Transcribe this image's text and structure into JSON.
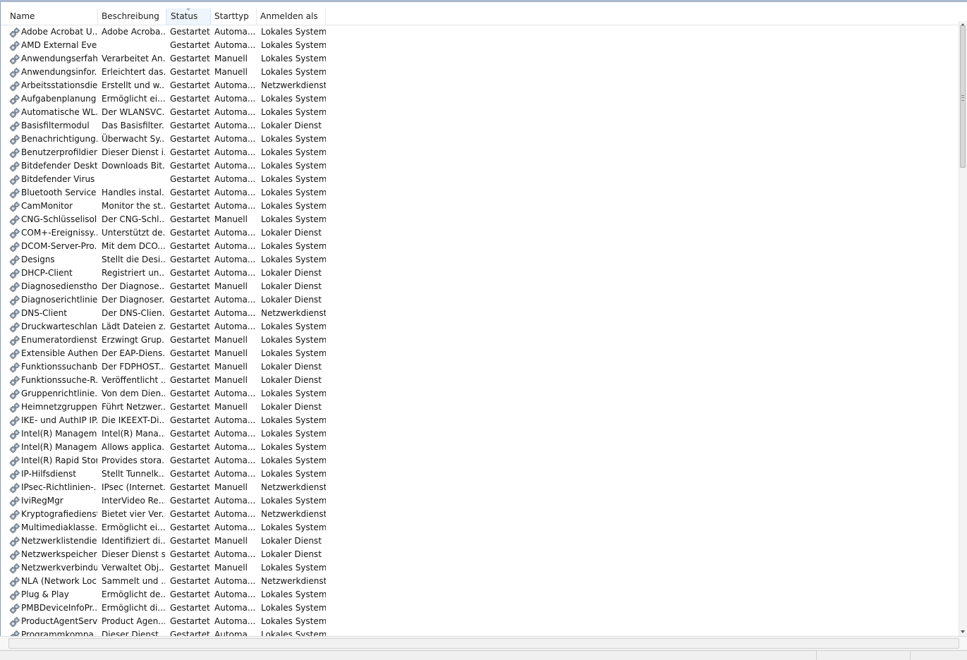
{
  "columns": [
    "Name",
    "Beschreibung",
    "Status",
    "Starttyp",
    "Anmelden als"
  ],
  "sorted_column": "Status",
  "icon": "gear-icon",
  "services": [
    [
      "Adobe Acrobat U...",
      "Adobe Acroba...",
      "Gestartet",
      "Automa...",
      "Lokales System"
    ],
    [
      "AMD External Eve...",
      "",
      "Gestartet",
      "Automa...",
      "Lokales System"
    ],
    [
      "Anwendungserfah...",
      "Verarbeitet An...",
      "Gestartet",
      "Manuell",
      "Lokales System"
    ],
    [
      "Anwendungsinfor...",
      "Erleichtert das...",
      "Gestartet",
      "Manuell",
      "Lokales System"
    ],
    [
      "Arbeitsstationsdie...",
      "Erstellt und w...",
      "Gestartet",
      "Automa...",
      "Netzwerkdienst"
    ],
    [
      "Aufgabenplanung",
      "Ermöglicht ei...",
      "Gestartet",
      "Automa...",
      "Lokales System"
    ],
    [
      "Automatische WL...",
      "Der WLANSVC...",
      "Gestartet",
      "Automa...",
      "Lokales System"
    ],
    [
      "Basisfiltermodul",
      "Das Basisfilter...",
      "Gestartet",
      "Automa...",
      "Lokaler Dienst"
    ],
    [
      "Benachrichtigung...",
      "Überwacht Sy...",
      "Gestartet",
      "Automa...",
      "Lokales System"
    ],
    [
      "Benutzerprofildienst",
      "Dieser Dienst i...",
      "Gestartet",
      "Automa...",
      "Lokales System"
    ],
    [
      "Bitdefender Deskt...",
      "Downloads Bit...",
      "Gestartet",
      "Automa...",
      "Lokales System"
    ],
    [
      "Bitdefender Virus ...",
      "",
      "Gestartet",
      "Automa...",
      "Lokales System"
    ],
    [
      "Bluetooth Service",
      "Handles instal...",
      "Gestartet",
      "Automa...",
      "Lokales System"
    ],
    [
      "CamMonitor",
      "Monitor the st...",
      "Gestartet",
      "Automa...",
      "Lokales System"
    ],
    [
      "CNG-Schlüsselisol...",
      "Der CNG-Schl...",
      "Gestartet",
      "Manuell",
      "Lokales System"
    ],
    [
      "COM+-Ereignissy...",
      "Unterstützt de...",
      "Gestartet",
      "Automa...",
      "Lokaler Dienst"
    ],
    [
      "DCOM-Server-Pro...",
      "Mit dem DCO...",
      "Gestartet",
      "Automa...",
      "Lokales System"
    ],
    [
      "Designs",
      "Stellt die Desi...",
      "Gestartet",
      "Automa...",
      "Lokales System"
    ],
    [
      "DHCP-Client",
      "Registriert un...",
      "Gestartet",
      "Automa...",
      "Lokaler Dienst"
    ],
    [
      "Diagnosediensthost",
      "Der Diagnose...",
      "Gestartet",
      "Manuell",
      "Lokaler Dienst"
    ],
    [
      "Diagnoserichtlinie...",
      "Der Diagnoser...",
      "Gestartet",
      "Automa...",
      "Lokaler Dienst"
    ],
    [
      "DNS-Client",
      "Der DNS-Clien...",
      "Gestartet",
      "Automa...",
      "Netzwerkdienst"
    ],
    [
      "Druckwarteschlan...",
      "Lädt Dateien z...",
      "Gestartet",
      "Automa...",
      "Lokales System"
    ],
    [
      "Enumeratordienst ...",
      "Erzwingt Grup...",
      "Gestartet",
      "Manuell",
      "Lokales System"
    ],
    [
      "Extensible Authen...",
      "Der EAP-Diens...",
      "Gestartet",
      "Manuell",
      "Lokales System"
    ],
    [
      "Funktionssuchanb...",
      "Der FDPHOST...",
      "Gestartet",
      "Manuell",
      "Lokaler Dienst"
    ],
    [
      "Funktionssuche-R...",
      "Veröffentlicht ...",
      "Gestartet",
      "Manuell",
      "Lokaler Dienst"
    ],
    [
      "Gruppenrichtlinie...",
      "Von dem Dien...",
      "Gestartet",
      "Automa...",
      "Lokales System"
    ],
    [
      "Heimnetzgruppen...",
      "Führt Netzwer...",
      "Gestartet",
      "Manuell",
      "Lokaler Dienst"
    ],
    [
      "IKE- und AuthIP IP...",
      "Die IKEEXT-Di...",
      "Gestartet",
      "Automa...",
      "Lokales System"
    ],
    [
      "Intel(R) Managem...",
      "Intel(R) Mana...",
      "Gestartet",
      "Automa...",
      "Lokales System"
    ],
    [
      "Intel(R) Managem...",
      "Allows applica...",
      "Gestartet",
      "Automa...",
      "Lokales System"
    ],
    [
      "Intel(R) Rapid Stor...",
      "Provides stora...",
      "Gestartet",
      "Automa...",
      "Lokales System"
    ],
    [
      "IP-Hilfsdienst",
      "Stellt Tunnelk...",
      "Gestartet",
      "Automa...",
      "Lokales System"
    ],
    [
      "IPsec-Richtlinien-...",
      "IPsec (Internet...",
      "Gestartet",
      "Manuell",
      "Netzwerkdienst"
    ],
    [
      "IviRegMgr",
      "InterVideo Re...",
      "Gestartet",
      "Automa...",
      "Lokales System"
    ],
    [
      "Kryptografiedienste",
      "Bietet vier Ver...",
      "Gestartet",
      "Automa...",
      "Netzwerkdienst"
    ],
    [
      "Multimediaklasse...",
      "Ermöglicht ei...",
      "Gestartet",
      "Automa...",
      "Lokales System"
    ],
    [
      "Netzwerklistendie...",
      "Identifiziert di...",
      "Gestartet",
      "Manuell",
      "Lokaler Dienst"
    ],
    [
      "Netzwerkspeicher...",
      "Dieser Dienst s...",
      "Gestartet",
      "Automa...",
      "Lokaler Dienst"
    ],
    [
      "Netzwerkverbindu...",
      "Verwaltet Obj...",
      "Gestartet",
      "Manuell",
      "Lokales System"
    ],
    [
      "NLA (Network Loc...",
      "Sammelt und ...",
      "Gestartet",
      "Automa...",
      "Netzwerkdienst"
    ],
    [
      "Plug & Play",
      "Ermöglicht de...",
      "Gestartet",
      "Automa...",
      "Lokales System"
    ],
    [
      "PMBDeviceInfoPr...",
      "Ermöglicht di...",
      "Gestartet",
      "Automa...",
      "Lokales System"
    ],
    [
      "ProductAgentServ...",
      "Product Agen...",
      "Gestartet",
      "Automa...",
      "Lokales System"
    ],
    [
      "Programmkompa...",
      "Dieser Dienst ...",
      "Gestartet",
      "Automa...",
      "Lokales System"
    ]
  ]
}
